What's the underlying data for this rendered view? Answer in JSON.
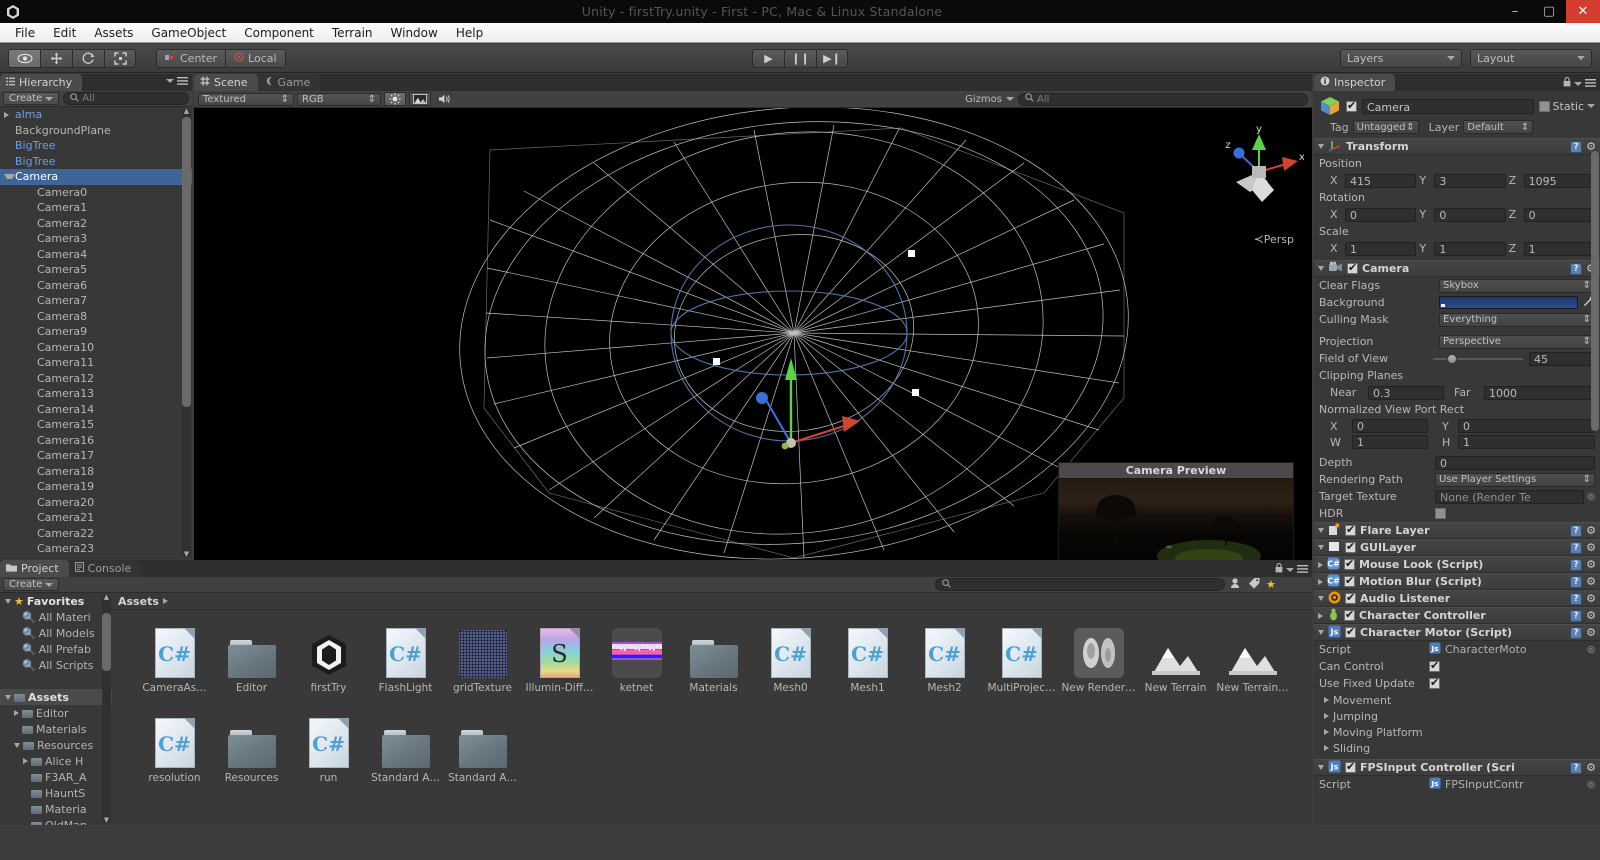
{
  "window": {
    "title": "Unity - firstTry.unity - First - PC, Mac & Linux Standalone",
    "minimize": "–",
    "maximize": "▢",
    "close": "✕"
  },
  "menubar": {
    "items": [
      "File",
      "Edit",
      "Assets",
      "GameObject",
      "Component",
      "Terrain",
      "Window",
      "Help"
    ]
  },
  "toolbar": {
    "tools": [
      "hand-tool",
      "move-tool",
      "rotate-tool",
      "scale-tool"
    ],
    "pivot_mode": "Center",
    "pivot_rotation": "Local",
    "play": "▶",
    "pause": "❙❙",
    "step": "▶❙",
    "layers": "Layers",
    "layout": "Layout"
  },
  "hierarchy": {
    "tab": "Hierarchy",
    "create": "Create",
    "search_placeholder": "All",
    "items": [
      {
        "label": "alma",
        "indent": 0,
        "arrow": "right",
        "style": "prefab"
      },
      {
        "label": "BackgroundPlane",
        "indent": 0,
        "arrow": "",
        "style": "normal"
      },
      {
        "label": "BigTree",
        "indent": 0,
        "arrow": "",
        "style": "prefab"
      },
      {
        "label": "BigTree",
        "indent": 0,
        "arrow": "",
        "style": "prefab"
      },
      {
        "label": "Camera",
        "indent": 0,
        "arrow": "down",
        "style": "selected"
      },
      {
        "label": "Camera0",
        "indent": 1,
        "arrow": "",
        "style": "normal"
      },
      {
        "label": "Camera1",
        "indent": 1,
        "arrow": "",
        "style": "normal"
      },
      {
        "label": "Camera2",
        "indent": 1,
        "arrow": "",
        "style": "normal"
      },
      {
        "label": "Camera3",
        "indent": 1,
        "arrow": "",
        "style": "normal"
      },
      {
        "label": "Camera4",
        "indent": 1,
        "arrow": "",
        "style": "normal"
      },
      {
        "label": "Camera5",
        "indent": 1,
        "arrow": "",
        "style": "normal"
      },
      {
        "label": "Camera6",
        "indent": 1,
        "arrow": "",
        "style": "normal"
      },
      {
        "label": "Camera7",
        "indent": 1,
        "arrow": "",
        "style": "normal"
      },
      {
        "label": "Camera8",
        "indent": 1,
        "arrow": "",
        "style": "normal"
      },
      {
        "label": "Camera9",
        "indent": 1,
        "arrow": "",
        "style": "normal"
      },
      {
        "label": "Camera10",
        "indent": 1,
        "arrow": "",
        "style": "normal"
      },
      {
        "label": "Camera11",
        "indent": 1,
        "arrow": "",
        "style": "normal"
      },
      {
        "label": "Camera12",
        "indent": 1,
        "arrow": "",
        "style": "normal"
      },
      {
        "label": "Camera13",
        "indent": 1,
        "arrow": "",
        "style": "normal"
      },
      {
        "label": "Camera14",
        "indent": 1,
        "arrow": "",
        "style": "normal"
      },
      {
        "label": "Camera15",
        "indent": 1,
        "arrow": "",
        "style": "normal"
      },
      {
        "label": "Camera16",
        "indent": 1,
        "arrow": "",
        "style": "normal"
      },
      {
        "label": "Camera17",
        "indent": 1,
        "arrow": "",
        "style": "normal"
      },
      {
        "label": "Camera18",
        "indent": 1,
        "arrow": "",
        "style": "normal"
      },
      {
        "label": "Camera19",
        "indent": 1,
        "arrow": "",
        "style": "normal"
      },
      {
        "label": "Camera20",
        "indent": 1,
        "arrow": "",
        "style": "normal"
      },
      {
        "label": "Camera21",
        "indent": 1,
        "arrow": "",
        "style": "normal"
      },
      {
        "label": "Camera22",
        "indent": 1,
        "arrow": "",
        "style": "normal"
      },
      {
        "label": "Camera23",
        "indent": 1,
        "arrow": "",
        "style": "normal"
      }
    ]
  },
  "scene": {
    "tabs": [
      {
        "label": "Scene",
        "active": true
      },
      {
        "label": "Game",
        "active": false
      }
    ],
    "draw_mode": "Textured",
    "render_mode": "RGB",
    "toggles": [
      "lighting-icon",
      "gameoverlay-icon",
      "audio-icon"
    ],
    "gizmos": "Gizmos",
    "gizmo_search_placeholder": "All",
    "camera_preview_title": "Camera Preview",
    "persp_label": "Persp",
    "axis_labels": {
      "x": "x",
      "y": "y",
      "z": "z"
    }
  },
  "inspector": {
    "tab": "Inspector",
    "object_name": "Camera",
    "static_label": "Static",
    "tag_label": "Tag",
    "tag_value": "Untagged",
    "layer_label": "Layer",
    "layer_value": "Default",
    "transform": {
      "title": "Transform",
      "position_label": "Position",
      "position": {
        "x": "415",
        "y": "3",
        "z": "1095"
      },
      "rotation_label": "Rotation",
      "rotation": {
        "x": "0",
        "y": "0",
        "z": "0"
      },
      "scale_label": "Scale",
      "scale": {
        "x": "1",
        "y": "1",
        "z": "1"
      }
    },
    "camera": {
      "title": "Camera",
      "clear_flags_label": "Clear Flags",
      "clear_flags_value": "Skybox",
      "background_label": "Background",
      "background_color": "#22467f",
      "culling_mask_label": "Culling Mask",
      "culling_mask_value": "Everything",
      "projection_label": "Projection",
      "projection_value": "Perspective",
      "fov_label": "Field of View",
      "fov_value": "45",
      "clipping_label": "Clipping Planes",
      "near_label": "Near",
      "near_value": "0.3",
      "far_label": "Far",
      "far_value": "1000",
      "viewport_label": "Normalized View Port Rect",
      "viewport": {
        "x_label": "X",
        "x": "0",
        "y_label": "Y",
        "y": "0",
        "w_label": "W",
        "w": "1",
        "h_label": "H",
        "h": "1"
      },
      "depth_label": "Depth",
      "depth_value": "0",
      "rendering_path_label": "Rendering Path",
      "rendering_path_value": "Use Player Settings",
      "target_texture_label": "Target Texture",
      "target_texture_value": "None (Render Te",
      "hdr_label": "HDR"
    },
    "components": [
      {
        "title": "Flare Layer",
        "icon": "flare-icon",
        "expanded": true
      },
      {
        "title": "GUILayer",
        "icon": "guilayer-icon",
        "expanded": true
      },
      {
        "title": "Mouse Look (Script)",
        "icon": "csharp-script-icon",
        "expanded": false
      },
      {
        "title": "Motion Blur (Script)",
        "icon": "csharp-script-icon",
        "expanded": false
      },
      {
        "title": "Audio Listener",
        "icon": "audio-listener-icon",
        "expanded": true
      },
      {
        "title": "Character Controller",
        "icon": "character-controller-icon",
        "expanded": false
      }
    ],
    "character_motor": {
      "title": "Character Motor (Script)",
      "script_label": "Script",
      "script_value": "CharacterMoto",
      "can_control_label": "Can Control",
      "use_fixed_update_label": "Use Fixed Update",
      "sections": [
        "Movement",
        "Jumping",
        "Moving Platform",
        "Sliding"
      ]
    },
    "fps_input": {
      "title": "FPSInput Controller (Scri",
      "script_label": "Script",
      "script_value": "FPSInputContr"
    }
  },
  "project": {
    "tabs": [
      {
        "label": "Project",
        "active": true
      },
      {
        "label": "Console",
        "active": false
      }
    ],
    "create": "Create",
    "search_placeholder": "",
    "breadcrumb": "Assets",
    "tree": [
      {
        "label": "Favorites",
        "indent": 0,
        "arrow": "down",
        "icon": "star-icon",
        "bold": true
      },
      {
        "label": "All Materi",
        "indent": 1,
        "arrow": "",
        "icon": "search-icon",
        "bold": false
      },
      {
        "label": "All Models",
        "indent": 1,
        "arrow": "",
        "icon": "search-icon",
        "bold": false
      },
      {
        "label": "All Prefab",
        "indent": 1,
        "arrow": "",
        "icon": "search-icon",
        "bold": false
      },
      {
        "label": "All Scripts",
        "indent": 1,
        "arrow": "",
        "icon": "search-icon",
        "bold": false
      },
      {
        "label": "",
        "indent": 0,
        "arrow": "",
        "icon": "",
        "bold": false
      },
      {
        "label": "Assets",
        "indent": 0,
        "arrow": "down",
        "icon": "folder-icon",
        "bold": true,
        "selected": true
      },
      {
        "label": "Editor",
        "indent": 1,
        "arrow": "right",
        "icon": "folder-icon",
        "bold": false
      },
      {
        "label": "Materials",
        "indent": 1,
        "arrow": "",
        "icon": "folder-icon",
        "bold": false
      },
      {
        "label": "Resources",
        "indent": 1,
        "arrow": "down",
        "icon": "folder-icon",
        "bold": false
      },
      {
        "label": "Alice H",
        "indent": 2,
        "arrow": "right",
        "icon": "folder-icon",
        "bold": false
      },
      {
        "label": "F3AR_A",
        "indent": 2,
        "arrow": "",
        "icon": "folder-icon",
        "bold": false
      },
      {
        "label": "HauntS",
        "indent": 2,
        "arrow": "",
        "icon": "folder-icon",
        "bold": false
      },
      {
        "label": "Materia",
        "indent": 2,
        "arrow": "",
        "icon": "folder-icon",
        "bold": false
      },
      {
        "label": "OldMan",
        "indent": 2,
        "arrow": "",
        "icon": "folder-icon",
        "bold": false
      }
    ],
    "assets": [
      {
        "label": "CameraAs…",
        "icon": "csharp-file-icon"
      },
      {
        "label": "Editor",
        "icon": "folder-icon"
      },
      {
        "label": "firstTry",
        "icon": "unity-scene-icon"
      },
      {
        "label": "FlashLight",
        "icon": "csharp-file-icon"
      },
      {
        "label": "gridTexture",
        "icon": "texture-icon"
      },
      {
        "label": "Illumin-Diff…",
        "icon": "shader-icon"
      },
      {
        "label": "ketnet",
        "icon": "cubemap-icon"
      },
      {
        "label": "Materials",
        "icon": "folder-icon"
      },
      {
        "label": "Mesh0",
        "icon": "csharp-file-icon"
      },
      {
        "label": "Mesh1",
        "icon": "csharp-file-icon"
      },
      {
        "label": "Mesh2",
        "icon": "csharp-file-icon"
      },
      {
        "label": "MultiProjec…",
        "icon": "csharp-file-icon"
      },
      {
        "label": "New Render…",
        "icon": "rendertexture-icon"
      },
      {
        "label": "New Terrain",
        "icon": "terrain-icon"
      },
      {
        "label": "New Terrain…",
        "icon": "terrain-icon"
      },
      {
        "label": "resolution",
        "icon": "csharp-file-icon"
      },
      {
        "label": "Resources",
        "icon": "folder-icon"
      },
      {
        "label": "run",
        "icon": "csharp-file-icon"
      },
      {
        "label": "Standard A…",
        "icon": "folder-icon"
      },
      {
        "label": "Standard A…",
        "icon": "folder-icon"
      }
    ]
  }
}
